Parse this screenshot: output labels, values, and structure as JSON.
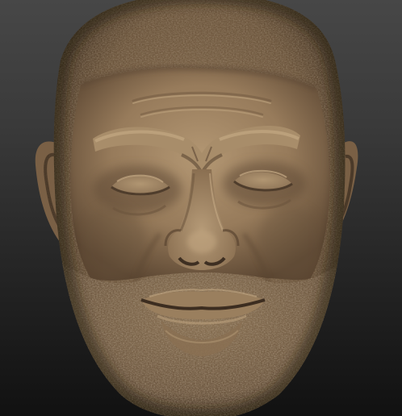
{
  "scene": {
    "subject": "sculpted-head",
    "material": "clay",
    "colors": {
      "background_top": "#474747",
      "background_bottom": "#111111",
      "clay_light": "#b39773",
      "clay_mid": "#8e7455",
      "clay_dark": "#4e3d2b",
      "hair_base": "#7a6145"
    }
  }
}
